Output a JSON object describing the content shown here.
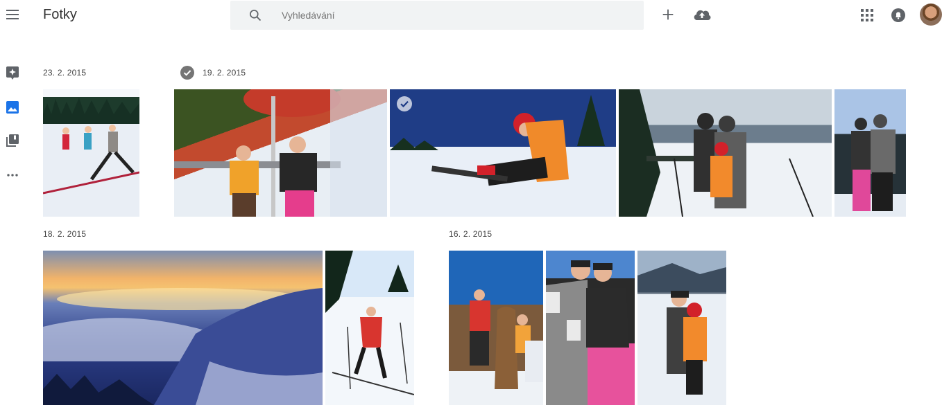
{
  "app": {
    "title": "Fotky"
  },
  "search": {
    "placeholder": "Vyhledávání",
    "value": ""
  },
  "colors": {
    "rail_active": "#1a73e8",
    "icon_gray": "#5f6368",
    "search_bg": "#f1f3f4"
  },
  "icons": {
    "menu": "hamburger-menu-icon",
    "search": "search-icon",
    "add": "plus-icon",
    "upload": "cloud-upload-icon",
    "apps": "apps-grid-icon",
    "notifications": "notifications-icon",
    "rail": [
      "assistant-icon",
      "photos-icon",
      "albums-icon",
      "more-icon"
    ]
  },
  "sections": [
    {
      "date": "23. 2. 2015",
      "selected": false,
      "photos": 1
    },
    {
      "date": "19. 2. 2015",
      "selected": true,
      "photos": 4
    },
    {
      "date": "18. 2. 2015",
      "selected": false,
      "photos": 2
    },
    {
      "date": "16. 2. 2015",
      "selected": false,
      "photos": 3
    }
  ]
}
